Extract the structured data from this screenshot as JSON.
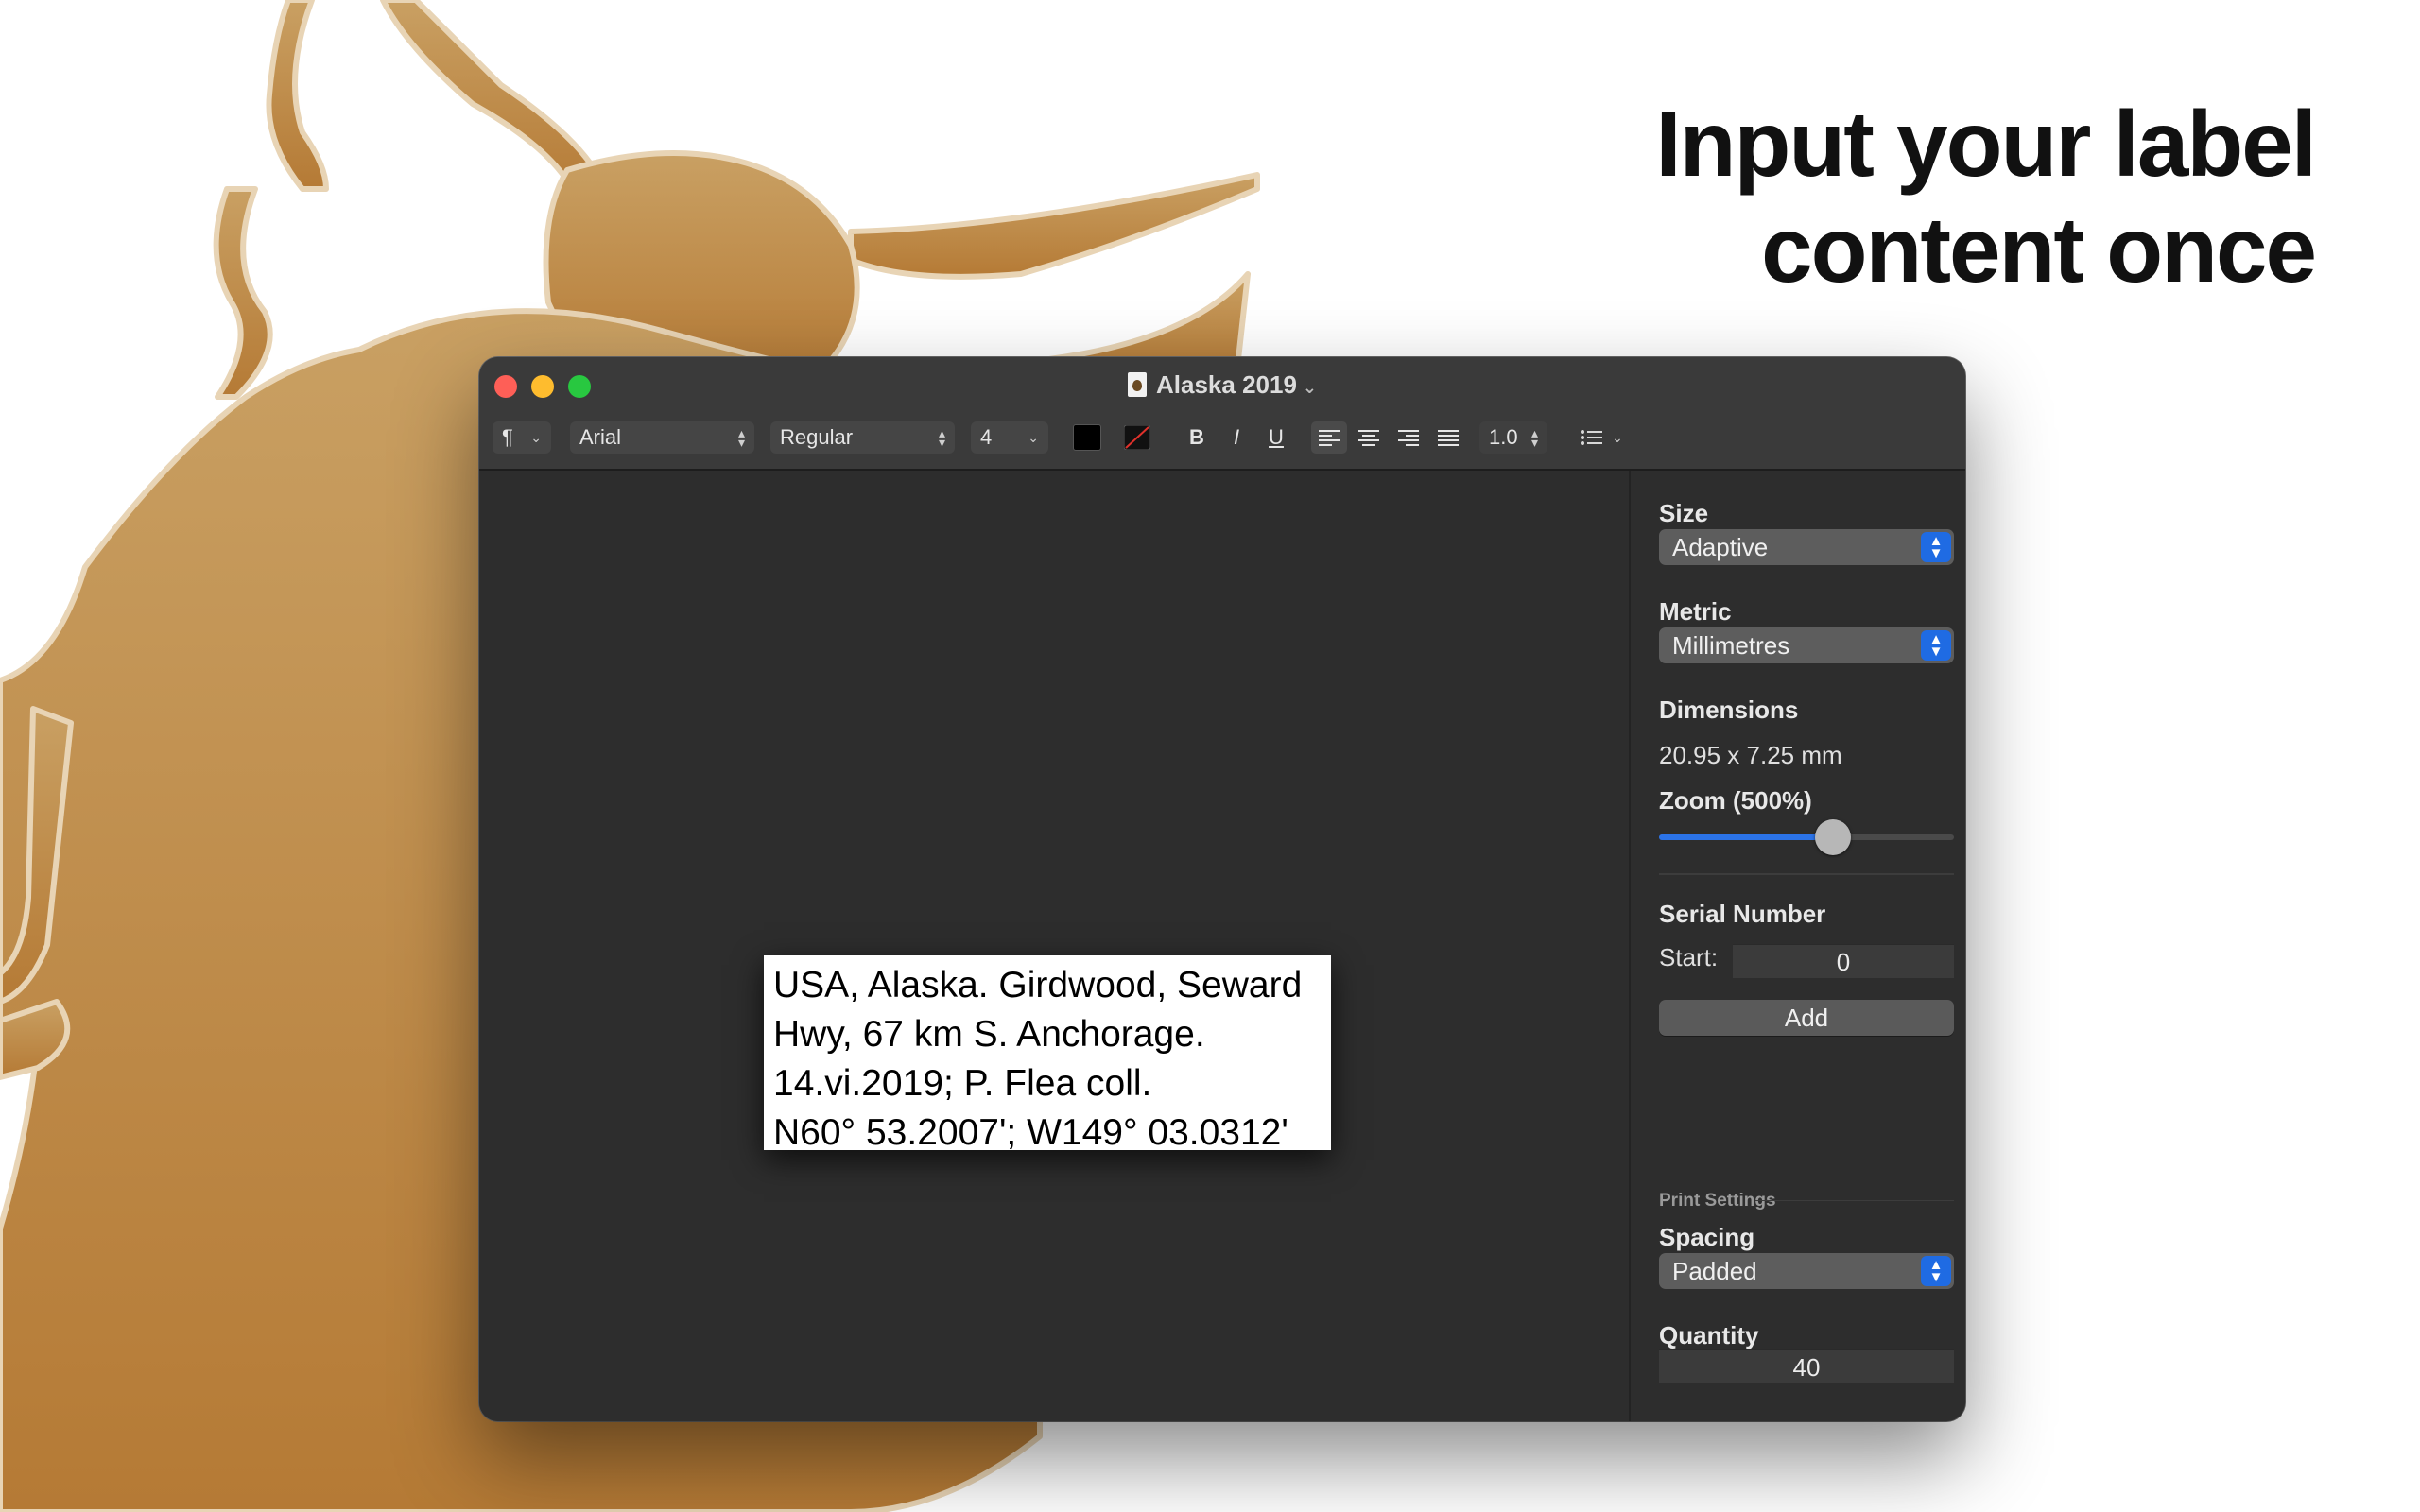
{
  "headline": {
    "line1": "Input your label",
    "line2": "content once"
  },
  "window": {
    "title": "Alaska 2019",
    "colors": {
      "close": "#fe5f57",
      "minimize": "#febc2e",
      "maximize": "#28c840",
      "accent": "#1f6be3"
    }
  },
  "toolbar": {
    "paragraph_glyph": "¶",
    "font_family": "Arial",
    "font_style": "Regular",
    "font_size": "4",
    "text_color": "#000000",
    "bold": "B",
    "italic": "I",
    "underline": "U",
    "line_spacing": "1.0",
    "icons": [
      "paragraph-style-icon",
      "chevron-down-icon",
      "up-down-arrows-icon",
      "text-color-swatch",
      "highlight-color-swatch",
      "align-left-icon",
      "align-center-icon",
      "align-right-icon",
      "justify-icon",
      "list-bullets-icon"
    ]
  },
  "label": {
    "lines": [
      "USA, Alaska. Girdwood, Seward",
      "Hwy, 67 km S. Anchorage.",
      "14.vi.2019; P. Flea coll.",
      "N60° 53.2007'; W149° 03.0312'"
    ]
  },
  "inspector": {
    "size_heading": "Size",
    "size_value": "Adaptive",
    "metric_heading": "Metric",
    "metric_value": "Millimetres",
    "dimensions_heading": "Dimensions",
    "dimensions_value": "20.95 x 7.25 mm",
    "zoom_heading": "Zoom (500%)",
    "zoom_fraction": 0.59,
    "serial_heading": "Serial Number",
    "start_label": "Start:",
    "start_value": "0",
    "add_button": "Add",
    "print_settings_caption": "Print Settings",
    "spacing_heading": "Spacing",
    "spacing_value": "Padded",
    "quantity_heading": "Quantity",
    "quantity_value": "40"
  }
}
